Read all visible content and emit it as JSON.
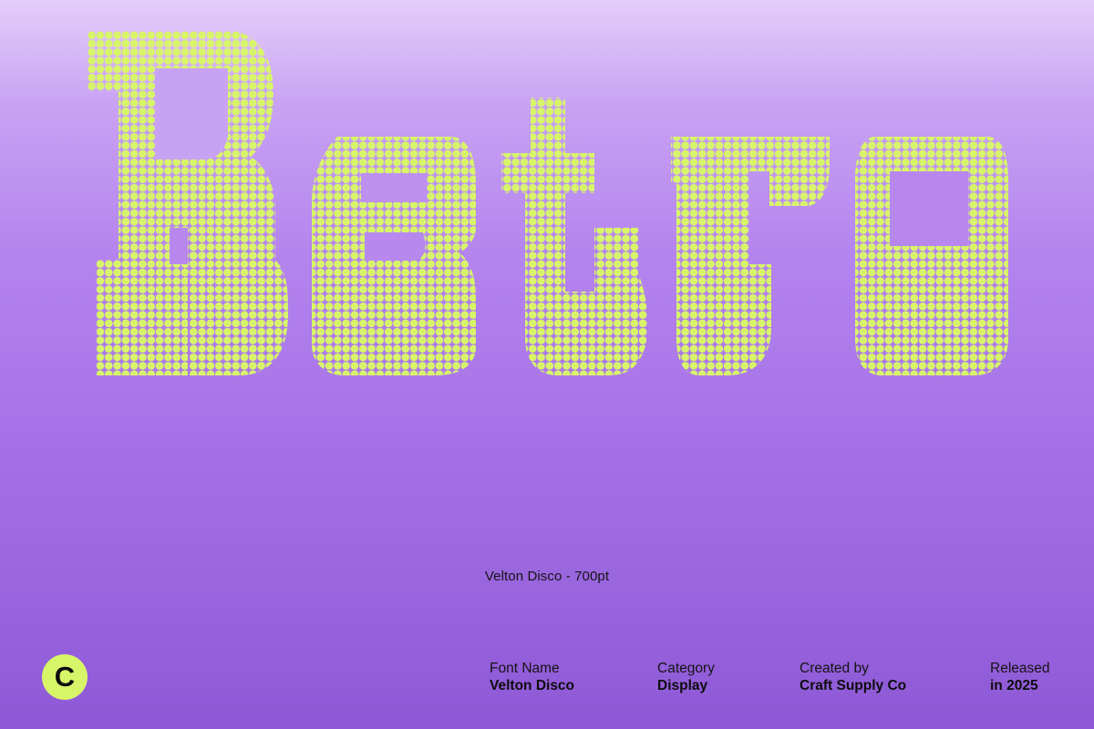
{
  "specimen": {
    "text": "Retro",
    "dot_color": "#d8f56a"
  },
  "caption": "Velton Disco - 700pt",
  "brand": {
    "logo_letter": "C",
    "logo_color": "#d8f56a"
  },
  "meta": {
    "font_name_label": "Font Name",
    "font_name_value": "Velton Disco",
    "category_label": "Category",
    "category_value": "Display",
    "created_by_label": "Created by",
    "created_by_value": "Craft Supply Co",
    "released_label": "Released",
    "released_value": "in 2025"
  }
}
